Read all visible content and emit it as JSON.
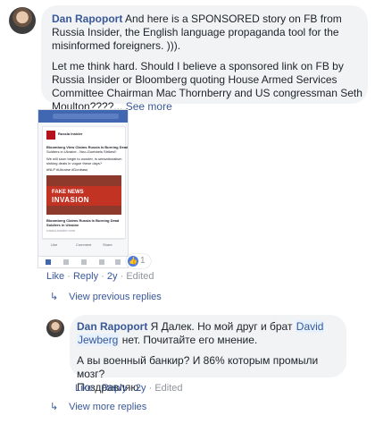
{
  "comment": {
    "author": "Dan Rapoport",
    "text_line1": " And here is a SPONSORED story on FB from",
    "text_line2": "Russia Insider, the English language propaganda tool for the",
    "text_line3": "misinformed foreigners. ))).",
    "text2_line1": "Let me think hard. Should I believe a sponsored link on FB by",
    "text2_line2": "Russia Insider or Bloomberg quoting House Armed Services",
    "text2_line3": "Committee Chairman Mac Thornberry and US congressman Seth",
    "text2_line4": "Moulton????...",
    "see_more": "See more",
    "reaction_count": "1",
    "meta": {
      "like": "Like",
      "reply": "Reply",
      "time": "2y",
      "edited": "Edited",
      "dot": "·"
    }
  },
  "attachment": {
    "page_name": "Russia Insider",
    "headline1": "Bloomberg View Claims Russia Is Burning Dead",
    "headline2": "Soldiers in Ukraine - Neo-Goebbels Strikes!!",
    "body1": "We will soon begin to wonder, is sensationalism",
    "body2": "sinking deals in vogue these days?",
    "tags": "#NLP #Ukraine #Donbass",
    "image_text1": "FAKE NEWS",
    "image_text2": "INVASION",
    "link_title1": "Bloomberg Claims Russia Is Burning Dead",
    "link_title2": "Soldiers in Ukraine",
    "link_domain": "russia-insider.com",
    "actions": [
      "Like",
      "Comment",
      "Share"
    ]
  },
  "view_previous": "View previous replies",
  "reply": {
    "author": "Dan Rapoport",
    "text_a": " Я Далек. Но мой друг и брат ",
    "mention_1": "David",
    "mention_2": "Jewberg",
    "text_b": " нет. Почитайте его мнение.",
    "text2_line1": "А вы военный банкир? И 86% которым промыли мозг?",
    "text2_line2": "Поздравляю.",
    "meta": {
      "like": "Like",
      "reply": "Reply",
      "time": "2y",
      "edited": "Edited",
      "dot": "·"
    }
  },
  "view_more": "View more replies",
  "icons": {
    "reply_arrow": "reply-arrow-icon",
    "like": "like-reaction-icon"
  },
  "colors": {
    "link": "#385898",
    "bubble": "#f2f3f5",
    "fb_blue": "#4267b2"
  }
}
